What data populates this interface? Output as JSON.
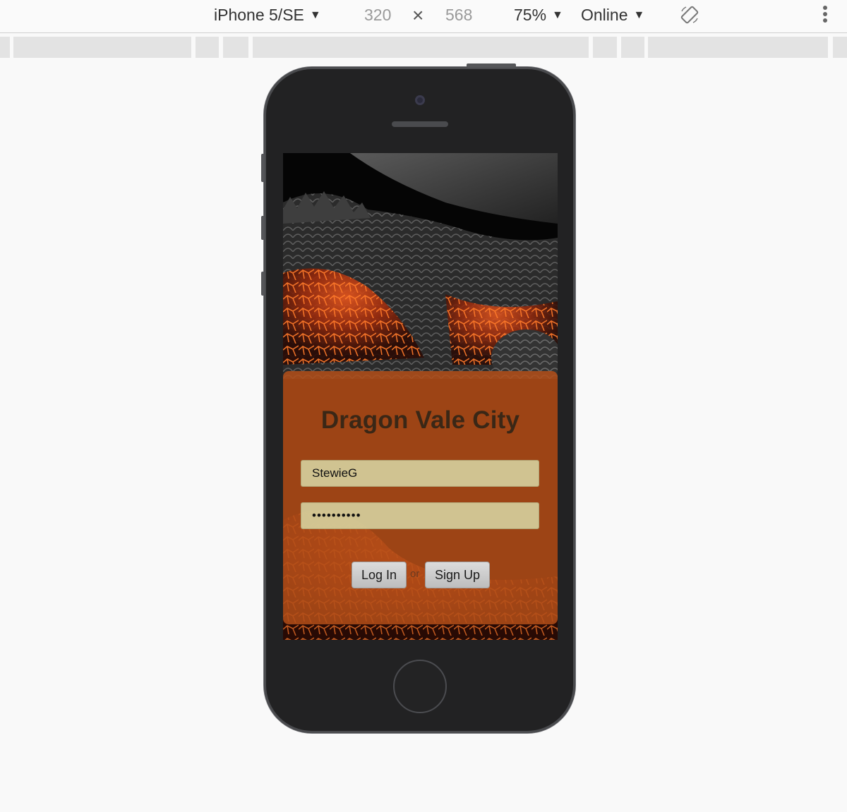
{
  "devtools": {
    "device": "iPhone 5/SE",
    "width": "320",
    "height": "568",
    "zoom": "75%",
    "network": "Online",
    "caret": "▼",
    "times": "×"
  },
  "app": {
    "title": "Dragon Vale City",
    "username_value": "StewieG",
    "password_mask": "••••••••••",
    "login_label": "Log In",
    "or_label": "or",
    "signup_label": "Sign Up"
  },
  "icons": {
    "device_dropdown": "chevron-down-icon",
    "rotate": "rotate-icon",
    "menu": "more-vertical-icon",
    "camera": "camera-icon",
    "home": "home-button-icon"
  },
  "colors": {
    "card": "#b24e19",
    "input_bg": "#d6d29e",
    "title": "#3a2716",
    "lava": "#e2521c"
  }
}
